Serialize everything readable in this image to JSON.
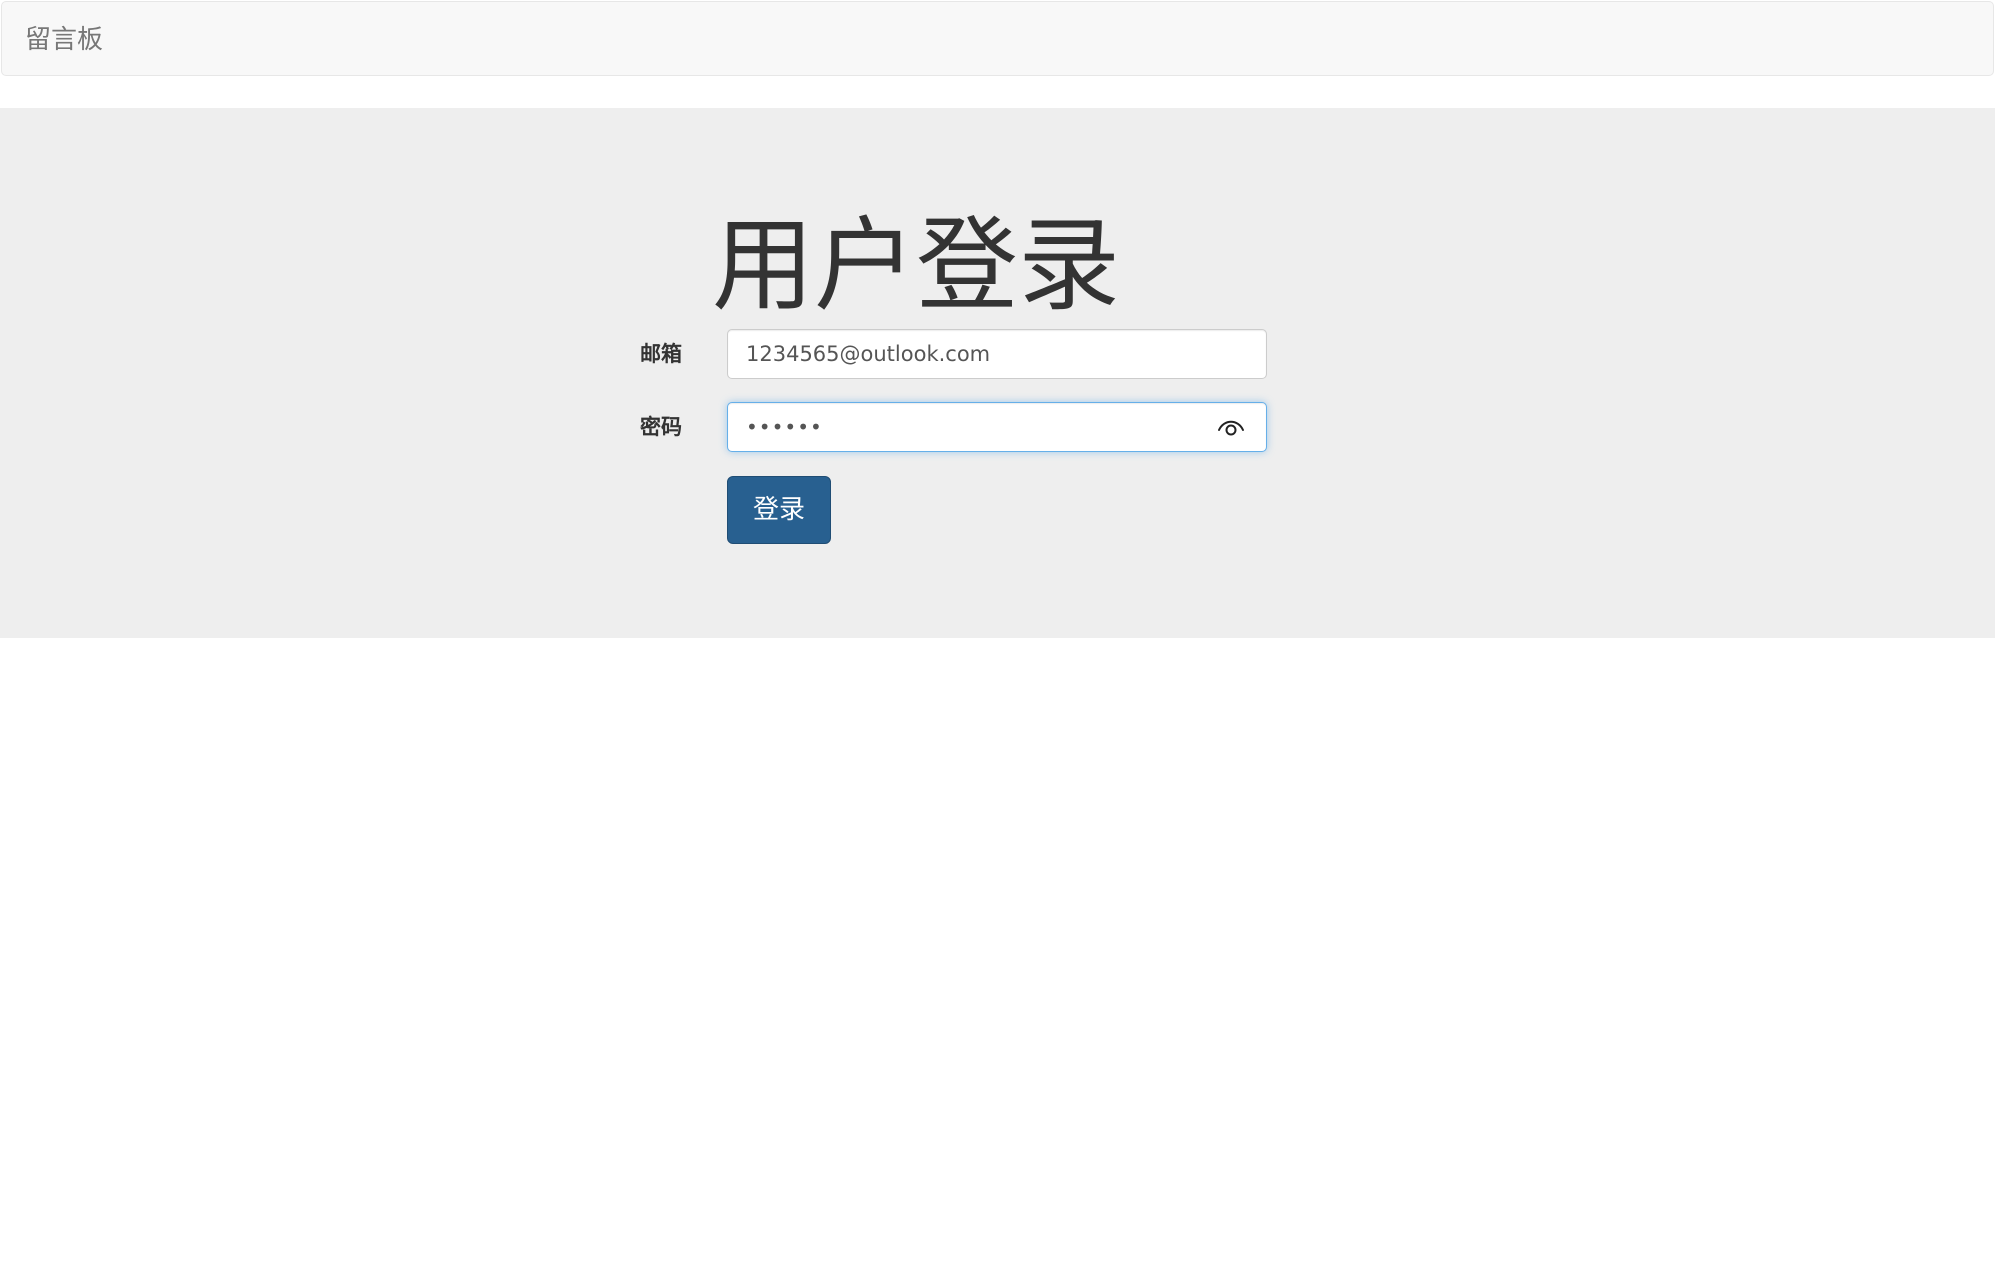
{
  "navbar": {
    "brand": "留言板"
  },
  "login": {
    "title": "用户登录",
    "email_label": "邮箱",
    "email_value": "1234565@outlook.com",
    "password_label": "密码",
    "password_value": "••••••",
    "show_password_icon": "eye-icon",
    "submit_label": "登录"
  },
  "colors": {
    "primary_button": "#286090",
    "jumbotron_bg": "#eeeeee",
    "navbar_bg": "#f8f8f8",
    "focus_border": "#66afe9"
  }
}
